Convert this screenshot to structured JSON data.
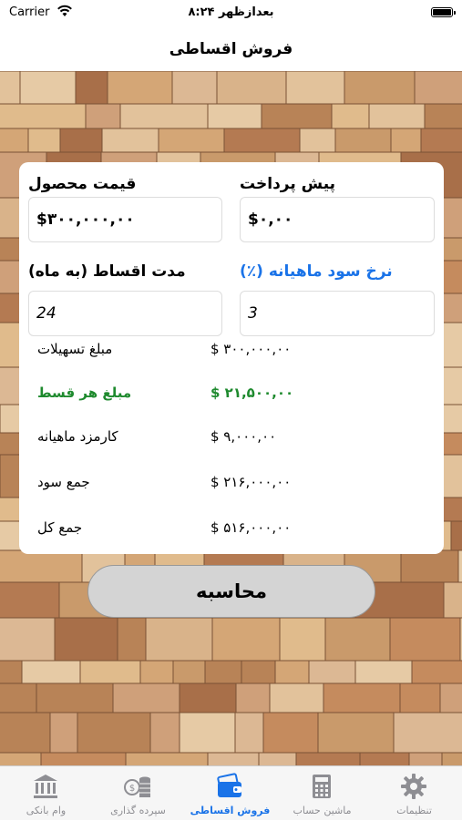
{
  "status_bar": {
    "carrier": "Carrier",
    "time": "۸:۲۴ بعدازظهر"
  },
  "nav": {
    "title": "فروش اقساطی"
  },
  "form": {
    "product_price_label": "قیمت محصول",
    "product_price_value": "$۳۰۰,۰۰۰,۰۰",
    "down_payment_label": "پیش پرداخت",
    "down_payment_value": "$۰,۰۰",
    "installment_period_label": "مدت اقساط (به ماه)",
    "installment_period_value": "24",
    "monthly_rate_label": "نرخ سود ماهیانه (٪)",
    "monthly_rate_value": "3"
  },
  "results": [
    {
      "name": "مبلغ تسهیلات",
      "value": "$ ۳۰۰,۰۰۰,۰۰"
    },
    {
      "name": "مبلغ هر قسط",
      "value": "$ ۲۱,۵۰۰,۰۰"
    },
    {
      "name": "کارمزد ماهیانه",
      "value": "$ ۹,۰۰۰,۰۰"
    },
    {
      "name": "جمع سود",
      "value": "$ ۲۱۶,۰۰۰,۰۰"
    },
    {
      "name": "جمع کل",
      "value": "$ ۵۱۶,۰۰۰,۰۰"
    }
  ],
  "calculate_button": "محاسبه",
  "tabs": [
    {
      "label": "وام بانکی",
      "icon": "bank-icon"
    },
    {
      "label": "سپرده گذاری",
      "icon": "coins-icon"
    },
    {
      "label": "فروش اقساطی",
      "icon": "wallet-icon"
    },
    {
      "label": "ماشین حساب",
      "icon": "calculator-icon"
    },
    {
      "label": "تنظیمات",
      "icon": "gear-icon"
    }
  ],
  "colors": {
    "accent": "#1a73e8",
    "highlight": "#1e8a2e",
    "wood_bg": "#c9a070"
  }
}
